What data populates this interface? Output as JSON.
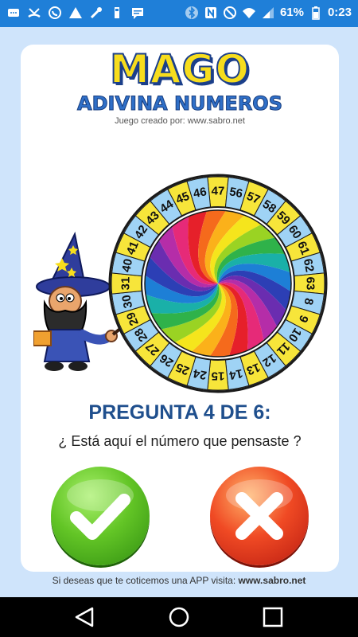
{
  "status_bar": {
    "battery": "61%",
    "time": "0:23",
    "icons_left": [
      "message-icon",
      "missed-call-icon",
      "whatsapp-icon",
      "alert-icon",
      "tools-icon",
      "usb-icon",
      "chat-icon"
    ],
    "icons_right": [
      "bluetooth-icon",
      "nfc-icon",
      "block-icon",
      "wifi-icon",
      "signal-icon",
      "battery-icon"
    ]
  },
  "logo": {
    "title": "MAGO",
    "subtitle": "ADIVINA NUMEROS",
    "credit": "Juego creado por: www.sabro.net"
  },
  "wheel": {
    "numbers": [
      "47",
      "56",
      "57",
      "58",
      "59",
      "60",
      "61",
      "62",
      "63",
      "8",
      "9",
      "10",
      "11",
      "12",
      "13",
      "14",
      "15",
      "24",
      "25",
      "26",
      "27",
      "28",
      "29",
      "30",
      "31",
      "40",
      "41",
      "42",
      "43",
      "44",
      "45",
      "46"
    ]
  },
  "question": {
    "title": "PREGUNTA 4 DE 6:",
    "prompt": "¿ Está aquí el número que pensaste ?"
  },
  "answers": {
    "yes_icon": "check-icon",
    "no_icon": "cross-icon"
  },
  "footer": {
    "text": "Si deseas que te coticemos una APP visita:",
    "link": "www.sabro.net"
  },
  "colors": {
    "status_bar": "#1f7fd8",
    "background": "#cfe4fb",
    "question_title": "#1f4f8d",
    "wheel_yellow": "#f7e53a",
    "wheel_blue": "#9fd3f5"
  }
}
